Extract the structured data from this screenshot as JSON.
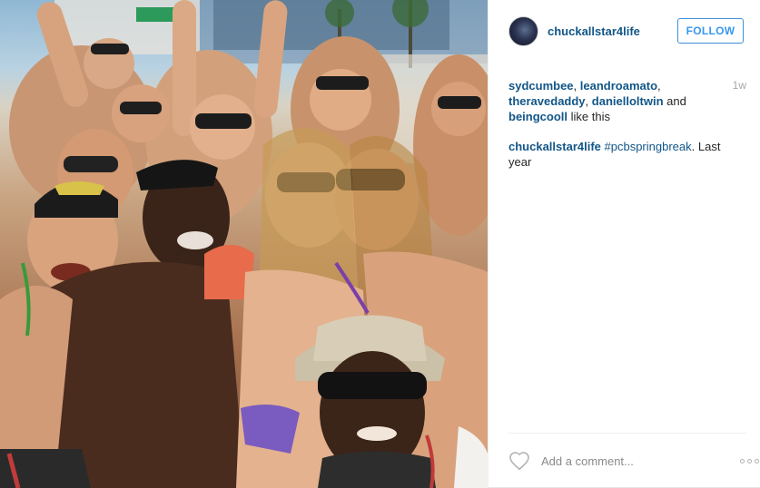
{
  "post": {
    "author": "chuckallstar4life",
    "follow_label": "FOLLOW",
    "likes": {
      "likers": [
        "sydcumbee",
        "leandroamato",
        "theravedaddy",
        "danielloltwin",
        "beingcooll"
      ],
      "separator": ", ",
      "conjunction": " and ",
      "suffix": " like this"
    },
    "age": "1w",
    "caption": {
      "user": "chuckallstar4life",
      "hashtag": "#pcbspringbreak",
      "text": ". Last year"
    },
    "comment_placeholder": "Add a comment...",
    "colors": {
      "link": "#125688",
      "follow_blue": "#3897f0",
      "muted": "#a5a7aa"
    },
    "icons": {
      "like": "heart-outline-icon",
      "options": "more-options-icon"
    }
  }
}
